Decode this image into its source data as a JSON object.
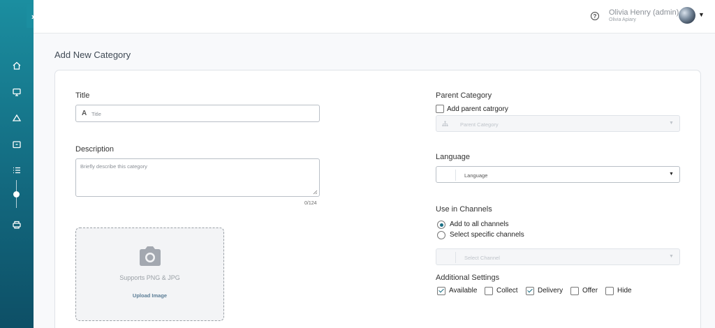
{
  "sidebar": {
    "toggle_icon": "chevron-right-icon",
    "items": [
      {
        "icon": "home-icon"
      },
      {
        "icon": "monitor-icon"
      },
      {
        "icon": "triangle-icon"
      },
      {
        "icon": "folder-icon"
      },
      {
        "icon": "list-icon"
      },
      {
        "icon": "slider-icon"
      },
      {
        "icon": "printer-icon"
      }
    ]
  },
  "header": {
    "help_icon": "?",
    "user_name": "Olivia Henry (admin)",
    "user_org": "Olivia Apiary",
    "caret": "▼"
  },
  "page": {
    "title": "Add New Category"
  },
  "form": {
    "title": {
      "label": "Title",
      "placeholder": "Title",
      "icon": "A"
    },
    "description": {
      "label": "Description",
      "placeholder": "Briefly describe this category",
      "counter": "0/124"
    },
    "upload": {
      "support_text": "Supports PNG & JPG",
      "button_label": "Upload Image"
    },
    "parent_category": {
      "label": "Parent Category",
      "checkbox_label": "Add parent catrgory",
      "checked": false,
      "placeholder": "Parent Category"
    },
    "language": {
      "label": "Language",
      "placeholder": "Language"
    },
    "channels": {
      "label": "Use in Channels",
      "options": [
        {
          "label": "Add to all channels",
          "selected": true
        },
        {
          "label": "Select specific channels",
          "selected": false
        }
      ],
      "select_placeholder": "Select Channel"
    },
    "additional_settings": {
      "label": "Additional Settings",
      "options": [
        {
          "label": "Available",
          "checked": true
        },
        {
          "label": "Collect",
          "checked": false
        },
        {
          "label": "Delivery",
          "checked": true
        },
        {
          "label": "Offer",
          "checked": false
        },
        {
          "label": "Hide",
          "checked": false
        }
      ]
    }
  },
  "colors": {
    "sidebar": "#1b8ea0",
    "accent": "#1b6f85"
  }
}
